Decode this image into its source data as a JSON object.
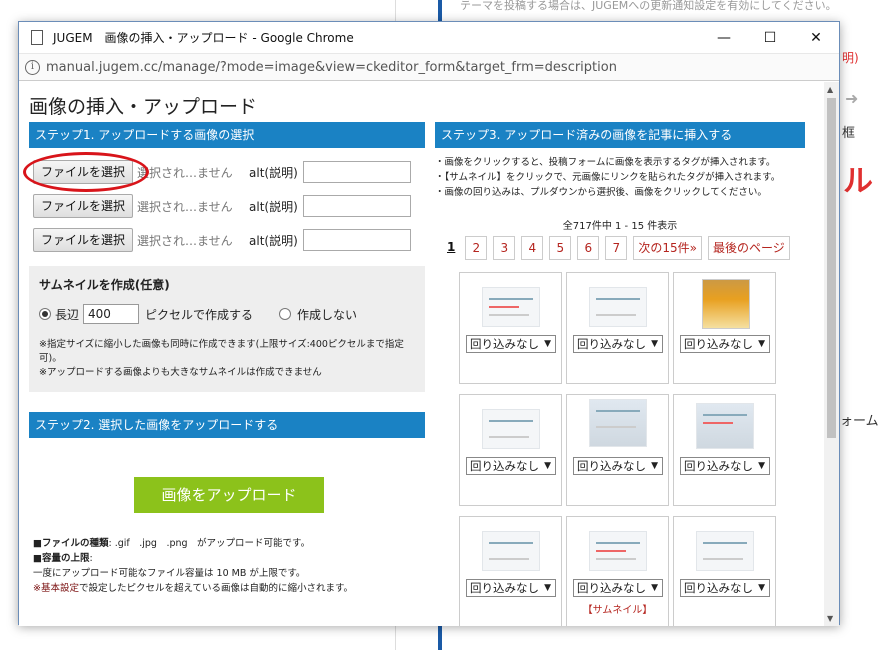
{
  "background": {
    "top_text": "テーマを投稿する場合は、JUGEMへの更新通知設定を有効にしてください。",
    "red_text": "明)",
    "partial_big": "ル",
    "partial_right": "ォーム",
    "partial_frame": "框"
  },
  "window": {
    "title": "JUGEM　画像の挿入・アップロード - Google Chrome",
    "url": "manual.jugem.cc/manage/?mode=image&view=ckeditor_form&target_frm=description",
    "minimize": "—",
    "maximize": "☐",
    "close": "✕"
  },
  "page": {
    "title": "画像の挿入・アップロード"
  },
  "step1": {
    "heading": "ステップ1. アップロードする画像の選択",
    "rows": [
      {
        "button": "ファイルを選択",
        "status": "選択され…ません",
        "alt_label": "alt(説明)",
        "alt_value": ""
      },
      {
        "button": "ファイルを選択",
        "status": "選択され…ません",
        "alt_label": "alt(説明)",
        "alt_value": ""
      },
      {
        "button": "ファイルを選択",
        "status": "選択され…ません",
        "alt_label": "alt(説明)",
        "alt_value": ""
      }
    ]
  },
  "thumbnail": {
    "title": "サムネイルを作成(任意)",
    "option1_label": "長辺",
    "px_value": "400",
    "px_suffix": "ピクセルで作成する",
    "option2_label": "作成しない",
    "selected": "option1",
    "note1": "※指定サイズに縮小した画像も同時に作成できます(上限サイズ:400ピクセルまで指定可)。",
    "note2": "※アップロードする画像よりも大きなサムネイルは作成できません"
  },
  "step2": {
    "heading": "ステップ2. 選択した画像をアップロードする",
    "upload_button": "画像をアップロード",
    "filetype_label": "■ファイルの種類",
    "filetype_text": ": .gif　.jpg　.png　がアップロード可能です。",
    "capacity_label": "■容量の上限",
    "capacity_suffix": ":",
    "capacity_text": "一度にアップロード可能なファイル容量は 10 MB が上限です。",
    "note_prefix": "※",
    "note_link": "基本設定",
    "note_text": "で設定したピクセルを超えている画像は自動的に縮小されます。"
  },
  "step3": {
    "heading": "ステップ3. アップロード済みの画像を記事に挿入する",
    "notes": [
      "・画像をクリックすると、投稿フォームに画像を表示するタグが挿入されます。",
      "・【サムネイル】をクリックで、元画像にリンクを貼られたタグが挿入されます。",
      "・画像の回り込みは、プルダウンから選択後、画像をクリックしてください。"
    ],
    "count": "全717件中 1 - 15 件表示",
    "pages": [
      "1",
      "2",
      "3",
      "4",
      "5",
      "6",
      "7"
    ],
    "next": "次の15件»",
    "last": "最後のページ",
    "current_page": "1",
    "wrap_option": "回り込みなし",
    "thumb_caption": "【サムネイル】"
  }
}
